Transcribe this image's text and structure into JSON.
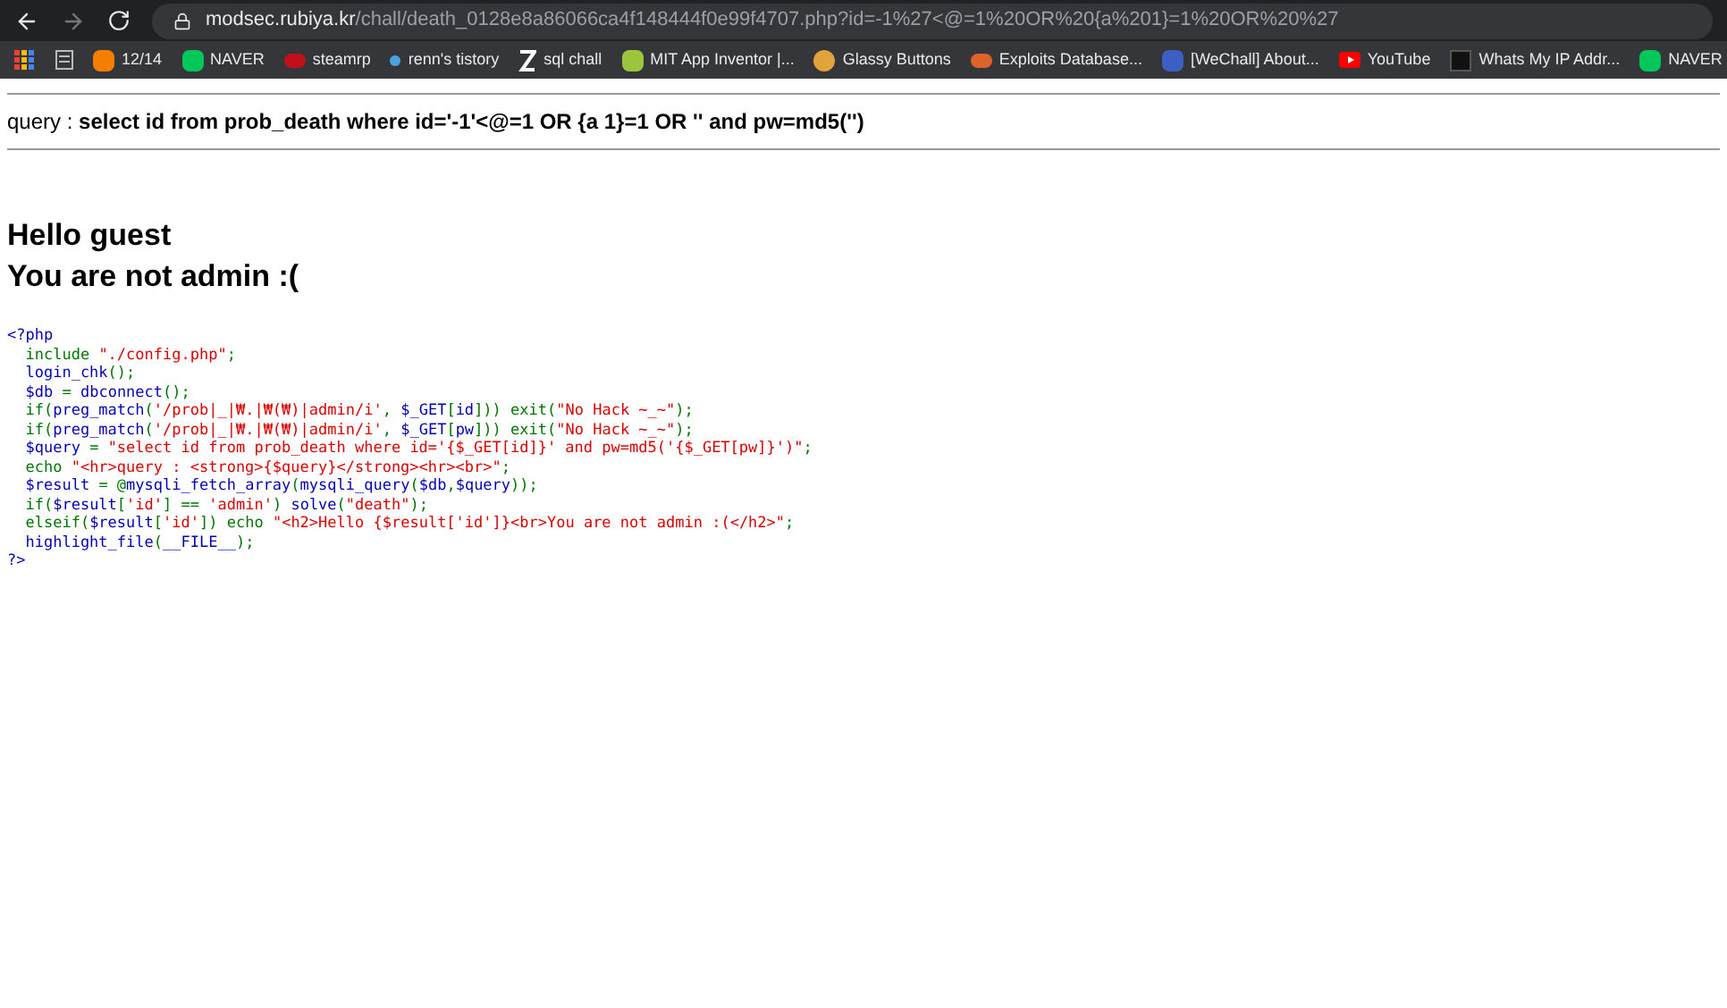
{
  "browser": {
    "url_host": "modsec.rubiya.kr",
    "url_path": "/chall/death_0128e8a86066ca4f148444f0e99f4707.php?id=-1%27<@=1%20OR%20{a%201}=1%20OR%20%27",
    "bookmarks": [
      {
        "kind": "apps"
      },
      {
        "kind": "doc"
      },
      {
        "kind": "blogger",
        "label": "12/14"
      },
      {
        "kind": "naver",
        "label": "NAVER"
      },
      {
        "kind": "steam",
        "label": "steamrp"
      },
      {
        "kind": "dot",
        "label": "renn's tistory"
      },
      {
        "kind": "z",
        "label": "sql chall"
      },
      {
        "kind": "mit",
        "label": "MIT App Inventor |..."
      },
      {
        "kind": "glassy",
        "label": "Glassy Buttons"
      },
      {
        "kind": "exploit",
        "label": "Exploits Database..."
      },
      {
        "kind": "wechall",
        "label": "[WeChall] About..."
      },
      {
        "kind": "youtube",
        "label": "YouTube"
      },
      {
        "kind": "ip",
        "label": "Whats My IP Addr..."
      },
      {
        "kind": "naver",
        "label": "NAVER"
      }
    ]
  },
  "page": {
    "query": "query : **select id from prob_death where id='-1'<@=1 OR {a 1}=1 OR '' and pw=md5('')**",
    "heading": [
      "Hello guest",
      "You are not admin :("
    ],
    "code": [
      [
        {
          "kind": "default",
          "text": "<?php"
        }
      ],
      [
        {
          "kind": "keyword",
          "text": "  include "
        },
        {
          "kind": "string",
          "text": "\"./config.php\""
        },
        {
          "kind": "keyword",
          "text": ";"
        }
      ],
      [
        {
          "kind": "default",
          "text": "  login_chk"
        },
        {
          "kind": "keyword",
          "text": "();"
        }
      ],
      [
        {
          "kind": "default",
          "text": "  $db "
        },
        {
          "kind": "keyword",
          "text": "= "
        },
        {
          "kind": "default",
          "text": "dbconnect"
        },
        {
          "kind": "keyword",
          "text": "();"
        }
      ],
      [
        {
          "kind": "keyword",
          "text": "  if("
        },
        {
          "kind": "default",
          "text": "preg_match"
        },
        {
          "kind": "keyword",
          "text": "("
        },
        {
          "kind": "string",
          "text": "'/prob|_|₩.|₩(₩)|admin/i'"
        },
        {
          "kind": "keyword",
          "text": ", "
        },
        {
          "kind": "default",
          "text": "$_GET"
        },
        {
          "kind": "keyword",
          "text": "["
        },
        {
          "kind": "default",
          "text": "id"
        },
        {
          "kind": "keyword",
          "text": "])) exit("
        },
        {
          "kind": "string",
          "text": "\"No Hack ~_~\""
        },
        {
          "kind": "keyword",
          "text": ");"
        }
      ],
      [
        {
          "kind": "keyword",
          "text": "  if("
        },
        {
          "kind": "default",
          "text": "preg_match"
        },
        {
          "kind": "keyword",
          "text": "("
        },
        {
          "kind": "string",
          "text": "'/prob|_|₩.|₩(₩)|admin/i'"
        },
        {
          "kind": "keyword",
          "text": ", "
        },
        {
          "kind": "default",
          "text": "$_GET"
        },
        {
          "kind": "keyword",
          "text": "["
        },
        {
          "kind": "default",
          "text": "pw"
        },
        {
          "kind": "keyword",
          "text": "])) exit("
        },
        {
          "kind": "string",
          "text": "\"No Hack ~_~\""
        },
        {
          "kind": "keyword",
          "text": ");"
        }
      ],
      [
        {
          "kind": "default",
          "text": "  $query "
        },
        {
          "kind": "keyword",
          "text": "= "
        },
        {
          "kind": "string",
          "text": "\"select id from prob_death where id='{$_GET[id]}' and pw=md5('{$_GET[pw]}')\""
        },
        {
          "kind": "keyword",
          "text": ";"
        }
      ],
      [
        {
          "kind": "keyword",
          "text": "  echo "
        },
        {
          "kind": "string",
          "text": "\"<hr>query : <strong>{$query}</strong><hr><br>\""
        },
        {
          "kind": "keyword",
          "text": ";"
        }
      ],
      [
        {
          "kind": "default",
          "text": "  $result "
        },
        {
          "kind": "keyword",
          "text": "= @"
        },
        {
          "kind": "default",
          "text": "mysqli_fetch_array"
        },
        {
          "kind": "keyword",
          "text": "("
        },
        {
          "kind": "default",
          "text": "mysqli_query"
        },
        {
          "kind": "keyword",
          "text": "("
        },
        {
          "kind": "default",
          "text": "$db"
        },
        {
          "kind": "keyword",
          "text": ","
        },
        {
          "kind": "default",
          "text": "$query"
        },
        {
          "kind": "keyword",
          "text": "));"
        }
      ],
      [
        {
          "kind": "keyword",
          "text": "  if("
        },
        {
          "kind": "default",
          "text": "$result"
        },
        {
          "kind": "keyword",
          "text": "["
        },
        {
          "kind": "string",
          "text": "'id'"
        },
        {
          "kind": "keyword",
          "text": "] == "
        },
        {
          "kind": "string",
          "text": "'admin'"
        },
        {
          "kind": "keyword",
          "text": ") "
        },
        {
          "kind": "default",
          "text": "solve"
        },
        {
          "kind": "keyword",
          "text": "("
        },
        {
          "kind": "string",
          "text": "\"death\""
        },
        {
          "kind": "keyword",
          "text": ");"
        }
      ],
      [
        {
          "kind": "keyword",
          "text": "  elseif("
        },
        {
          "kind": "default",
          "text": "$result"
        },
        {
          "kind": "keyword",
          "text": "["
        },
        {
          "kind": "string",
          "text": "'id'"
        },
        {
          "kind": "keyword",
          "text": "]) echo "
        },
        {
          "kind": "string",
          "text": "\"<h2>Hello {$result['id']}<br>You are not admin :(</h2>\""
        },
        {
          "kind": "keyword",
          "text": ";"
        }
      ],
      [
        {
          "kind": "default",
          "text": "  highlight_file"
        },
        {
          "kind": "keyword",
          "text": "("
        },
        {
          "kind": "default",
          "text": "__FILE__"
        },
        {
          "kind": "keyword",
          "text": ");"
        }
      ],
      [
        {
          "kind": "default",
          "text": "?>"
        }
      ]
    ]
  }
}
